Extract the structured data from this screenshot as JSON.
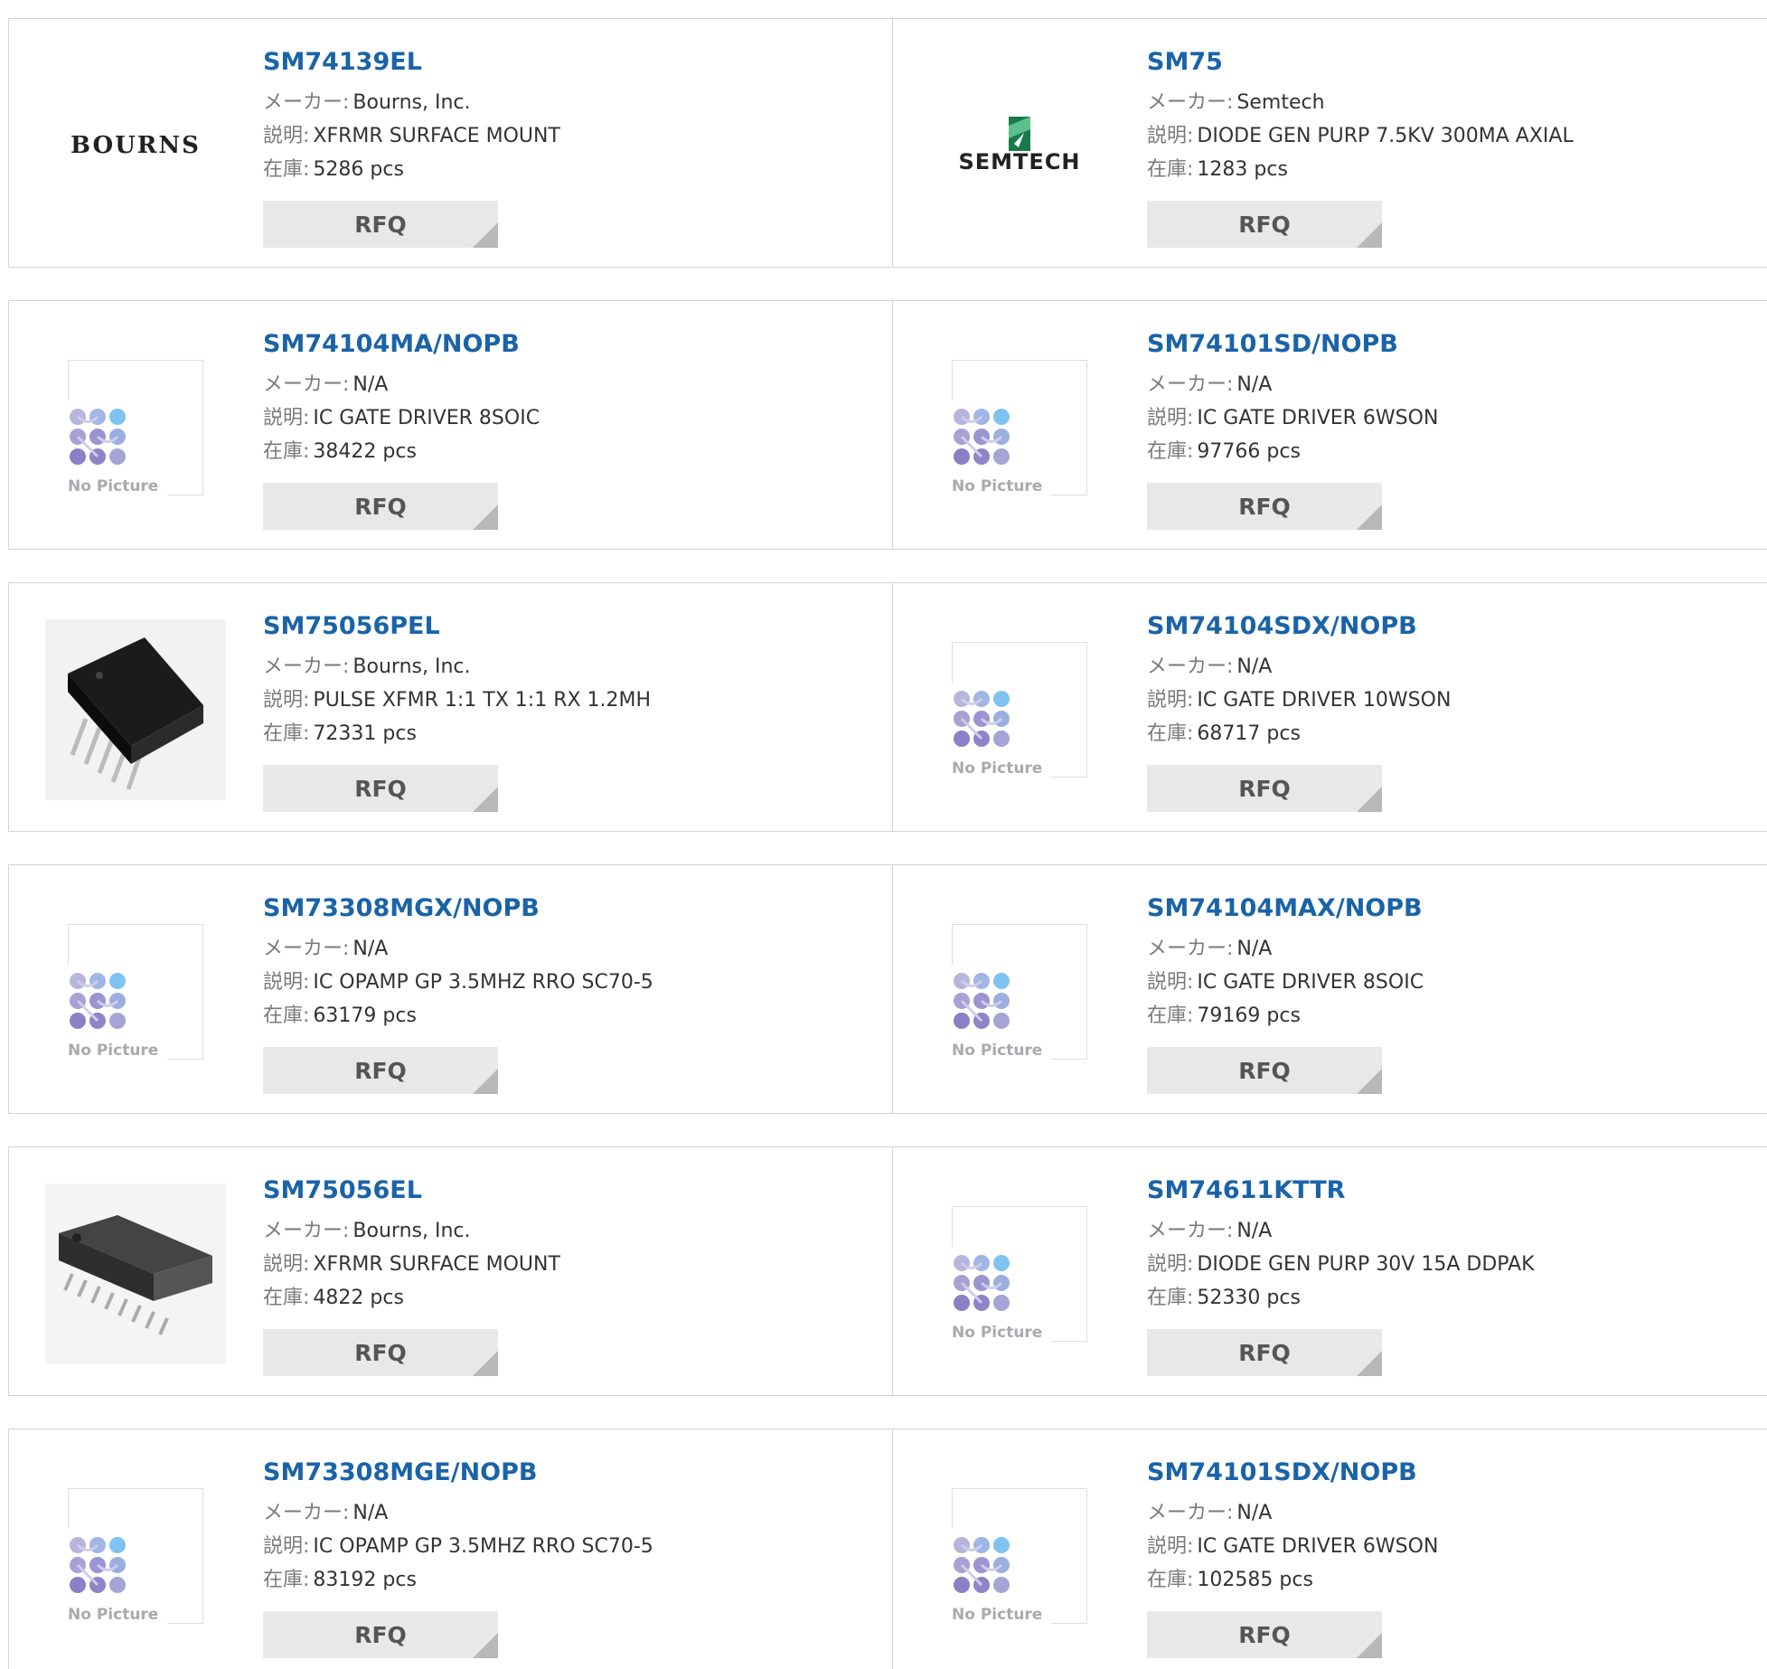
{
  "labels": {
    "maker": "メーカー:",
    "description": "説明:",
    "stock": "在庫:",
    "rfq": "RFQ",
    "no_picture": "No Picture"
  },
  "colors": {
    "link": "#1a63a8",
    "button_bg": "#e8e8e8",
    "border": "#d4d4d4"
  },
  "products": [
    {
      "part": "SM74139EL",
      "maker": "Bourns, Inc.",
      "description": "XFRMR SURFACE MOUNT",
      "stock": "5286 pcs",
      "image": "bourns-logo",
      "logo_text": "BOURNS"
    },
    {
      "part": "SM75",
      "maker": "Semtech",
      "description": "DIODE GEN PURP 7.5KV 300MA AXIAL",
      "stock": "1283 pcs",
      "image": "semtech-logo",
      "logo_text": "SEMTECH"
    },
    {
      "part": "SM74104MA/NOPB",
      "maker": "N/A",
      "description": "IC GATE DRIVER 8SOIC",
      "stock": "38422 pcs",
      "image": "no-picture"
    },
    {
      "part": "SM74101SD/NOPB",
      "maker": "N/A",
      "description": "IC GATE DRIVER 6WSON",
      "stock": "97766 pcs",
      "image": "no-picture"
    },
    {
      "part": "SM75056PEL",
      "maker": "Bourns, Inc.",
      "description": "PULSE XFMR 1:1 TX 1:1 RX 1.2MH",
      "stock": "72331 pcs",
      "image": "transformer-photo"
    },
    {
      "part": "SM74104SDX/NOPB",
      "maker": "N/A",
      "description": "IC GATE DRIVER 10WSON",
      "stock": "68717 pcs",
      "image": "no-picture"
    },
    {
      "part": "SM73308MGX/NOPB",
      "maker": "N/A",
      "description": "IC OPAMP GP 3.5MHZ RRO SC70-5",
      "stock": "63179 pcs",
      "image": "no-picture"
    },
    {
      "part": "SM74104MAX/NOPB",
      "maker": "N/A",
      "description": "IC GATE DRIVER 8SOIC",
      "stock": "79169 pcs",
      "image": "no-picture"
    },
    {
      "part": "SM75056EL",
      "maker": "Bourns, Inc.",
      "description": "XFRMR SURFACE MOUNT",
      "stock": "4822 pcs",
      "image": "smd-chip-photo"
    },
    {
      "part": "SM74611KTTR",
      "maker": "N/A",
      "description": "DIODE GEN PURP 30V 15A DDPAK",
      "stock": "52330 pcs",
      "image": "no-picture"
    },
    {
      "part": "SM73308MGE/NOPB",
      "maker": "N/A",
      "description": "IC OPAMP GP 3.5MHZ RRO SC70-5",
      "stock": "83192 pcs",
      "image": "no-picture"
    },
    {
      "part": "SM74101SDX/NOPB",
      "maker": "N/A",
      "description": "IC GATE DRIVER 6WSON",
      "stock": "102585 pcs",
      "image": "no-picture"
    }
  ]
}
